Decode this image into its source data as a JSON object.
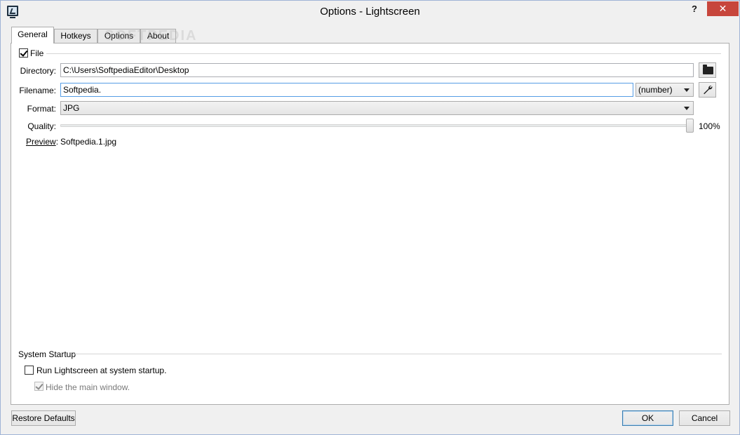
{
  "window": {
    "title": "Options - Lightscreen",
    "help_label": "?",
    "close_label": "✕"
  },
  "watermark": {
    "text": "SOFTPEDIA",
    "url": "www.softpedia.com"
  },
  "tabs": [
    {
      "label": "General",
      "active": true
    },
    {
      "label": "Hotkeys",
      "active": false
    },
    {
      "label": "Options",
      "active": false
    },
    {
      "label": "About",
      "active": false
    }
  ],
  "file_group": {
    "label": "File",
    "checked": true,
    "directory_label": "Directory:",
    "directory_value": "C:\\Users\\SoftpediaEditor\\Desktop",
    "filename_label": "Filename:",
    "filename_value": "Softpedia.",
    "naming_option": "(number)",
    "format_label": "Format:",
    "format_value": "JPG",
    "quality_label": "Quality:",
    "quality_percent": 100,
    "quality_value": "100%",
    "preview_label": "Preview",
    "preview_colon": ":",
    "preview_value": "Softpedia.1.jpg"
  },
  "startup_group": {
    "title": "System Startup",
    "run_label": "Run Lightscreen at system startup.",
    "run_checked": false,
    "hide_label": "Hide the main window.",
    "hide_checked": true,
    "hide_enabled": false
  },
  "buttons": {
    "restore": "Restore Defaults",
    "ok": "OK",
    "cancel": "Cancel"
  },
  "colors": {
    "close_button": "#c7463c",
    "focus_border": "#569de5",
    "default_button_border": "#3c7fb1"
  }
}
